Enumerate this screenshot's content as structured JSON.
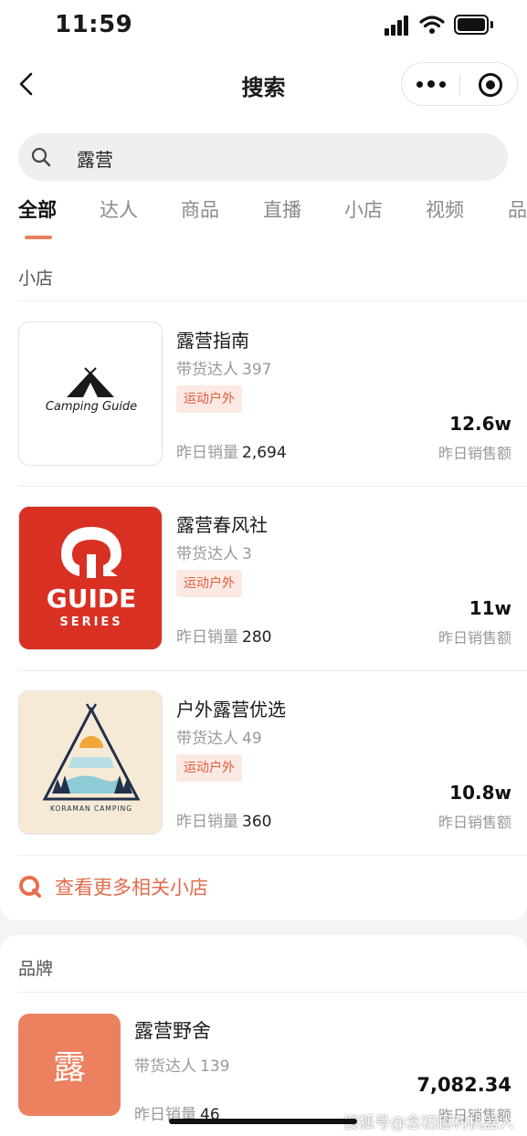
{
  "status": {
    "time": "11:59"
  },
  "nav": {
    "title": "搜索"
  },
  "search": {
    "query": "露营"
  },
  "tabs": [
    {
      "label": "全部",
      "active": true
    },
    {
      "label": "达人"
    },
    {
      "label": "商品"
    },
    {
      "label": "直播"
    },
    {
      "label": "小店"
    },
    {
      "label": "视频"
    },
    {
      "label": "品"
    }
  ],
  "shops_section": {
    "title": "小店",
    "items": [
      {
        "name": "露营指南",
        "creators_label": "带货达人",
        "creators": "397",
        "tag": "运动户外",
        "sales_label": "昨日销量",
        "sales": "2,694",
        "amount": "12.6w",
        "amount_label": "昨日销售额",
        "logo_text": "Camping Guide"
      },
      {
        "name": "露营春风社",
        "creators_label": "带货达人",
        "creators": "3",
        "tag": "运动户外",
        "sales_label": "昨日销量",
        "sales": "280",
        "amount": "11w",
        "amount_label": "昨日销售额",
        "logo_text": "GUIDE",
        "logo_subtext": "SERIES"
      },
      {
        "name": "户外露营优选",
        "creators_label": "带货达人",
        "creators": "49",
        "tag": "运动户外",
        "sales_label": "昨日销量",
        "sales": "360",
        "amount": "10.8w",
        "amount_label": "昨日销售额",
        "logo_text": "KORAMAN CAMPING"
      }
    ],
    "more_link": "查看更多相关小店"
  },
  "brands_section": {
    "title": "品牌",
    "items": [
      {
        "name": "露营野舍",
        "thumb_char": "露",
        "creators_label": "带货达人",
        "creators": "139",
        "sales_label": "昨日销量",
        "sales": "46",
        "amount": "7,082.34",
        "amount_label": "昨日销售额"
      }
    ]
  },
  "watermark": "搜狐号@念初趣利机器人",
  "colors": {
    "accent": "#ea7f5e",
    "tag_bg": "#fce9e3",
    "tag_text": "#e25c3d",
    "brand_thumb": "#ec8160",
    "guide_red": "#d93024",
    "page_bg": "#f4f4f4"
  },
  "icons": [
    "back-arrow-icon",
    "more-dots-icon",
    "target-icon",
    "search-icon",
    "q-search-icon",
    "signal-icon",
    "wifi-icon",
    "battery-icon"
  ]
}
